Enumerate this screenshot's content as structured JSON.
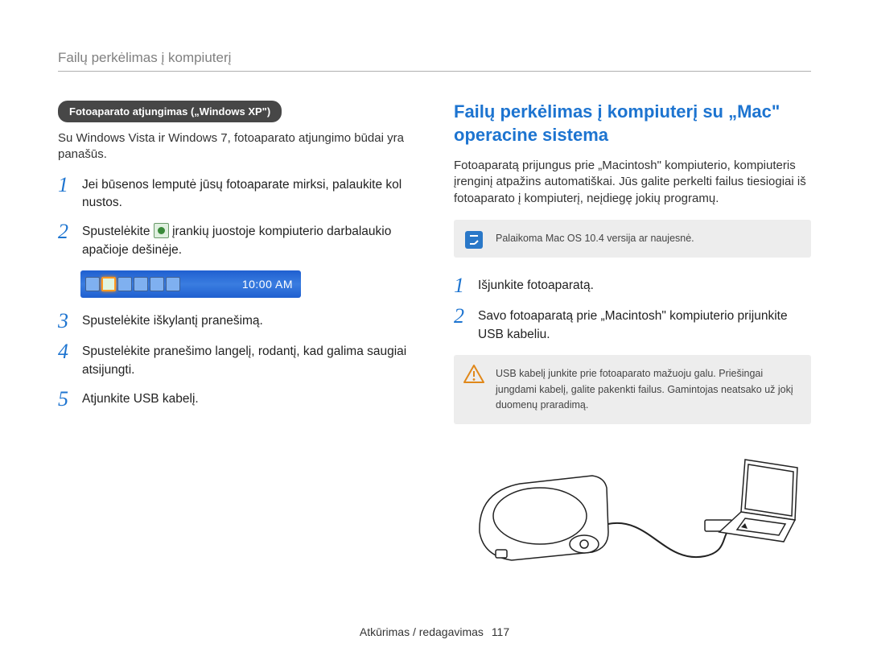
{
  "running_head": "Failų perkėlimas į kompiuterį",
  "left": {
    "pill": "Fotoaparato atjungimas („Windows XP\")",
    "intro": "Su Windows Vista ir Windows 7, fotoaparato atjungimo būdai yra panašūs.",
    "steps": [
      {
        "n": "1",
        "text": "Jei būsenos lemputė jūsų fotoaparate mirksi, palaukite kol nustos."
      },
      {
        "n": "2",
        "pre": "Spustelėkite ",
        "post": " įrankių juostoje kompiuterio darbalaukio apačioje dešinėje."
      },
      {
        "n": "3",
        "text": "Spustelėkite iškylantį pranešimą."
      },
      {
        "n": "4",
        "text": "Spustelėkite pranešimo langelį, rodantį, kad galima saugiai atsijungti."
      },
      {
        "n": "5",
        "text": "Atjunkite USB kabelį."
      }
    ],
    "taskbar_clock": "10:00 AM"
  },
  "right": {
    "title": "Failų perkėlimas į kompiuterį su „Mac\" operacine sistema",
    "intro": "Fotoaparatą prijungus prie „Macintosh\" kompiuterio, kompiuteris įrenginį atpažins automatiškai. Jūs galite perkelti failus tiesiogiai iš fotoaparato į kompiuterį, neįdiegę jokių programų.",
    "note_info": "Palaikoma Mac OS 10.4 versija ar naujesnė.",
    "steps": [
      {
        "n": "1",
        "text": "Išjunkite fotoaparatą."
      },
      {
        "n": "2",
        "text": "Savo fotoaparatą prie „Macintosh\" kompiuterio prijunkite USB kabeliu."
      }
    ],
    "note_warn": "USB kabelį junkite prie fotoaparato mažuoju galu. Priešingai jungdami kabelį, galite pakenkti failus. Gamintojas neatsako už jokį duomenų praradimą."
  },
  "footer": {
    "section": "Atkūrimas / redagavimas",
    "page": "117"
  }
}
